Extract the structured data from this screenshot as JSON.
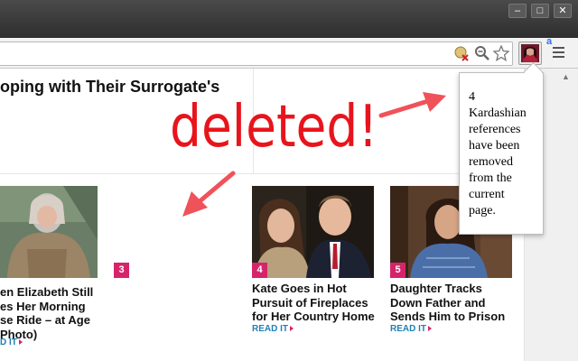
{
  "window": {
    "buttons": {
      "minimize": "–",
      "maximize": "□",
      "close": "✕"
    }
  },
  "toolbar": {
    "extension_badge": "a",
    "icons": [
      "page-blocked-icon",
      "search-icon",
      "star-icon",
      "kardashian-extension-icon",
      "menu-icon"
    ]
  },
  "article": {
    "headline": "oping with Their Surrogate's"
  },
  "overlay": {
    "deleted_text": "deleted!",
    "color": "#e8141c"
  },
  "stories": [
    {
      "badge": "",
      "title_lines": [
        "en Elizabeth Still",
        "es Her Morning",
        "se Ride – at Age",
        "Photo)"
      ],
      "read_label": "D IT"
    },
    {
      "badge": "3",
      "title_lines": [],
      "read_label": ""
    },
    {
      "badge": "4",
      "title_lines": [
        "Kate Goes in Hot",
        "Pursuit of Fireplaces",
        "for Her Country Home"
      ],
      "read_label": "READ IT"
    },
    {
      "badge": "5",
      "title_lines": [
        "Daughter Tracks",
        "Down Father and",
        "Sends Him to Prison"
      ],
      "read_label": "READ IT"
    }
  ],
  "popup": {
    "lines": [
      "4",
      "Kardashian",
      "references",
      "have been",
      "removed",
      "from the",
      "current",
      "page."
    ]
  },
  "colors": {
    "accent_pink": "#d6246b",
    "link_blue": "#1f7fb6",
    "arrow_red": "#f0525a"
  }
}
